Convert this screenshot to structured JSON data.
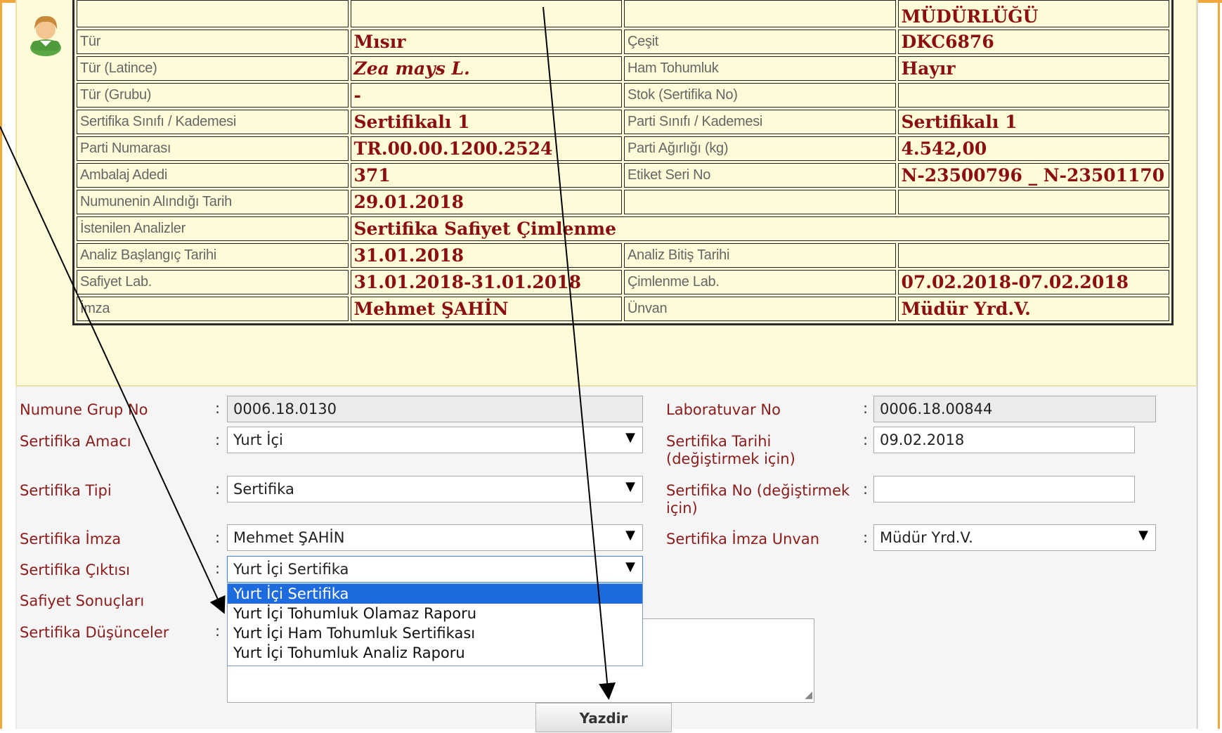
{
  "info_table": {
    "rows": [
      {
        "l1": "",
        "v1": "",
        "l2": "",
        "v2": "MÜDÜRLÜĞÜ"
      },
      {
        "l1": "Tür",
        "v1": "Mısır",
        "l2": "Çeşit",
        "v2": "DKC6876"
      },
      {
        "l1": "Tür (Latince)",
        "v1": "Zea mays L.",
        "l2": "Ham Tohumluk",
        "v2": "Hayır"
      },
      {
        "l1": "Tür (Grubu)",
        "v1": "-",
        "l2": "Stok (Sertifika No)",
        "v2": ""
      },
      {
        "l1": "Sertifika Sınıfı / Kademesi",
        "v1": "Sertifikalı 1",
        "l2": "Parti Sınıfı / Kademesi",
        "v2": "Sertifikalı 1"
      },
      {
        "l1": "Parti Numarası",
        "v1": "TR.00.00.1200.2524",
        "l2": "Parti Ağırlığı (kg)",
        "v2": "4.542,00"
      },
      {
        "l1": "Ambalaj Adedi",
        "v1": "371",
        "l2": "Etiket Seri No",
        "v2": "N-23500796 _ N-23501170"
      },
      {
        "l1": "Numunenin Alındığı Tarih",
        "v1": "29.01.2018",
        "l2": "",
        "v2": ""
      },
      {
        "l1": "İstenilen Analizler",
        "v1": "Sertifika Safiyet Çimlenme"
      },
      {
        "l1": "Analiz Başlangıç Tarihi",
        "v1": "31.01.2018",
        "l2": "Analiz Bitiş Tarihi",
        "v2": ""
      },
      {
        "l1": "Safiyet Lab.",
        "v1": "31.01.2018-31.01.2018",
        "l2": "Çimlenme Lab.",
        "v2": "07.02.2018-07.02.2018"
      },
      {
        "l1": "İmza",
        "v1": "Mehmet ŞAHİN",
        "l2": "Ünvan",
        "v2": "Müdür Yrd.V."
      }
    ]
  },
  "form": {
    "colon": ":",
    "numune_grup_no": {
      "label": "Numune Grup No",
      "value": "0006.18.0130"
    },
    "laboratuvar_no": {
      "label": "Laboratuvar No",
      "value": "0006.18.00844"
    },
    "sertifika_amaci": {
      "label": "Sertifika Amacı",
      "value": "Yurt İçi"
    },
    "sertifika_tarihi": {
      "label_line1": "Sertifika Tarihi",
      "label_line2": "(değiştirmek için)",
      "value": "09.02.2018"
    },
    "sertifika_tipi": {
      "label": "Sertifika Tipi",
      "value": "Sertifika"
    },
    "sertifika_no": {
      "label_line1": "Sertifika No (değiştirmek",
      "label_line2": "için)",
      "value": ""
    },
    "sertifika_imza": {
      "label": "Sertifika İmza",
      "value": "Mehmet ŞAHİN"
    },
    "sertifika_imza_unvan": {
      "label": "Sertifika İmza Unvan",
      "value": "Müdür Yrd.V."
    },
    "sertifika_ciktisi": {
      "label": "Sertifika Çıktısı",
      "value": "Yurt İçi Sertifika",
      "options": [
        "Yurt İçi Sertifika",
        "Yurt İçi Tohumluk Olamaz Raporu",
        "Yurt İçi Ham Tohumluk Sertifikası",
        "Yurt İçi Tohumluk Analiz Raporu"
      ]
    },
    "safiyet_sonuclari": {
      "label": "Safiyet Sonuçları"
    },
    "sertifika_dusunceler": {
      "label": "Sertifika Düşünceler"
    },
    "print_button": "Yazdir"
  },
  "icons": {
    "user": "user-icon",
    "dropdown_arrow": "▼"
  }
}
